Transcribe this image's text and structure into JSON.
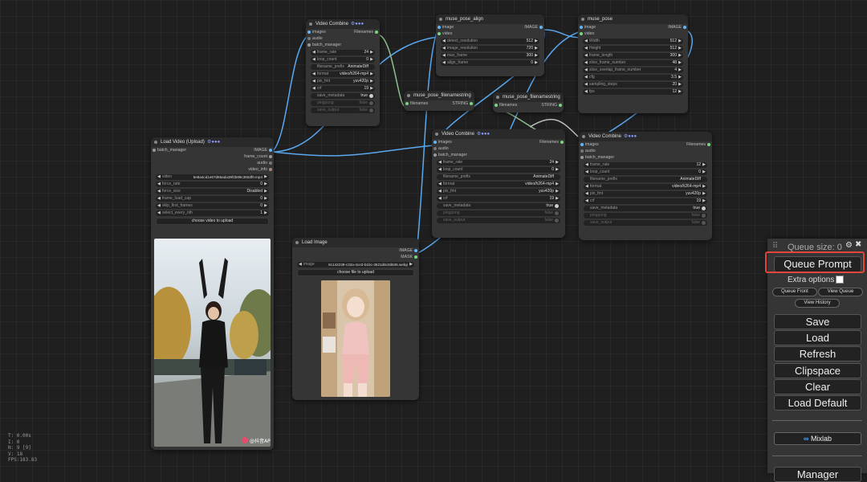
{
  "stats": {
    "t": "T: 0.00s",
    "i": "I: 0",
    "n": "N: 9 [9]",
    "v": "V: 18",
    "fps": "FPS:183.83"
  },
  "nodes": {
    "vc_top": {
      "title": "Video Combine",
      "inputs": [
        "images",
        "audio",
        "batch_manager"
      ],
      "output": "Filenames",
      "widgets": [
        {
          "label": "frame_rate",
          "value": "24"
        },
        {
          "label": "loop_count",
          "value": "0"
        },
        {
          "label": "filename_prefix",
          "value": "AnimateDiff"
        },
        {
          "label": "format",
          "value": "video/h264-mp4"
        },
        {
          "label": "pix_fmt",
          "value": "yuv420p"
        },
        {
          "label": "crf",
          "value": "19"
        },
        {
          "label": "save_metadata",
          "value": "true"
        },
        {
          "label": "pingpong",
          "value": "false"
        },
        {
          "label": "save_output",
          "value": "false"
        }
      ]
    },
    "align": {
      "title": "muse_pose_align",
      "inputs": [
        "image",
        "video"
      ],
      "output": "IMAGE",
      "widgets": [
        {
          "label": "detect_resolution",
          "value": "512"
        },
        {
          "label": "image_resolution",
          "value": "720"
        },
        {
          "label": "max_frame",
          "value": "300"
        },
        {
          "label": "align_frame",
          "value": "0"
        }
      ]
    },
    "pose": {
      "title": "muse_pose",
      "inputs": [
        "image",
        "video"
      ],
      "output": "IMAGE",
      "widgets": [
        {
          "label": "Width",
          "value": "512"
        },
        {
          "label": "Height",
          "value": "512"
        },
        {
          "label": "frame_length",
          "value": "300"
        },
        {
          "label": "slice_frame_number",
          "value": "48"
        },
        {
          "label": "slice_overlap_frame_number",
          "value": "4"
        },
        {
          "label": "cfg",
          "value": "3.5"
        },
        {
          "label": "sampling_steps",
          "value": "20"
        },
        {
          "label": "fps",
          "value": "12"
        }
      ]
    },
    "fn1": {
      "title": "muse_pose_filenamestring",
      "input": "filenames",
      "output": "STRING"
    },
    "fn2": {
      "title": "muse_pose_filenamestring",
      "input": "filenames",
      "output": "STRING"
    },
    "load_video": {
      "title": "Load Video (Upload)",
      "input": "batch_manager",
      "outputs": [
        "IMAGE",
        "frame_count",
        "audio",
        "video_info"
      ],
      "widgets": [
        {
          "label": "video",
          "value": "5e8a4cd1e67d65ada39f2b89c380df0.mp4"
        },
        {
          "label": "force_rate",
          "value": "0"
        },
        {
          "label": "force_size",
          "value": "Disabled"
        },
        {
          "label": "frame_load_cap",
          "value": "0"
        },
        {
          "label": "skip_first_frames",
          "value": "0"
        },
        {
          "label": "select_every_nth",
          "value": "1"
        }
      ],
      "upload_label": "choose video to upload",
      "watermark": "@抖音APP"
    },
    "load_image": {
      "title": "Load Image",
      "outputs": [
        "IMAGE",
        "MASK"
      ],
      "image_label": "image",
      "image_value": "8c142239-c32a-4ce3-b1bc-3621d6c0d645.webp",
      "upload_label": "choose file to upload"
    },
    "vc_mid": {
      "title": "Video Combine",
      "inputs": [
        "images",
        "audio",
        "batch_manager"
      ],
      "output": "Filenames",
      "widgets": [
        {
          "label": "frame_rate",
          "value": "24"
        },
        {
          "label": "loop_count",
          "value": "0"
        },
        {
          "label": "filename_prefix",
          "value": "AnimateDiff"
        },
        {
          "label": "format",
          "value": "video/h264-mp4"
        },
        {
          "label": "pix_fmt",
          "value": "yuv420p"
        },
        {
          "label": "crf",
          "value": "19"
        },
        {
          "label": "save_metadata",
          "value": "true"
        },
        {
          "label": "pingpong",
          "value": "false"
        },
        {
          "label": "save_output",
          "value": "false"
        }
      ]
    },
    "vc_right": {
      "title": "Video Combine",
      "inputs": [
        "images",
        "audio",
        "batch_manager"
      ],
      "output": "Filenames",
      "widgets": [
        {
          "label": "frame_rate",
          "value": "12"
        },
        {
          "label": "loop_count",
          "value": "0"
        },
        {
          "label": "filename_prefix",
          "value": "AnimateDiff"
        },
        {
          "label": "format",
          "value": "video/h264-mp4"
        },
        {
          "label": "pix_fmt",
          "value": "yuv420p"
        },
        {
          "label": "crf",
          "value": "19"
        },
        {
          "label": "save_metadata",
          "value": "true"
        },
        {
          "label": "pingpong",
          "value": "false"
        },
        {
          "label": "save_output",
          "value": "false"
        }
      ]
    }
  },
  "panel": {
    "queue_size": "Queue size: 0",
    "queue_prompt": "Queue Prompt",
    "extra_options": "Extra options",
    "queue_front": "Queue Front",
    "view_queue": "View Queue",
    "view_history": "View History",
    "save": "Save",
    "load": "Load",
    "refresh": "Refresh",
    "clipspace": "Clipspace",
    "clear": "Clear",
    "load_default": "Load Default",
    "mixlab": "Mixlab",
    "manager": "Manager"
  },
  "colors": {
    "link": "#5aa8f0",
    "highlight": "#e0463b",
    "background": "#1f1f1f",
    "node": "#353535"
  }
}
